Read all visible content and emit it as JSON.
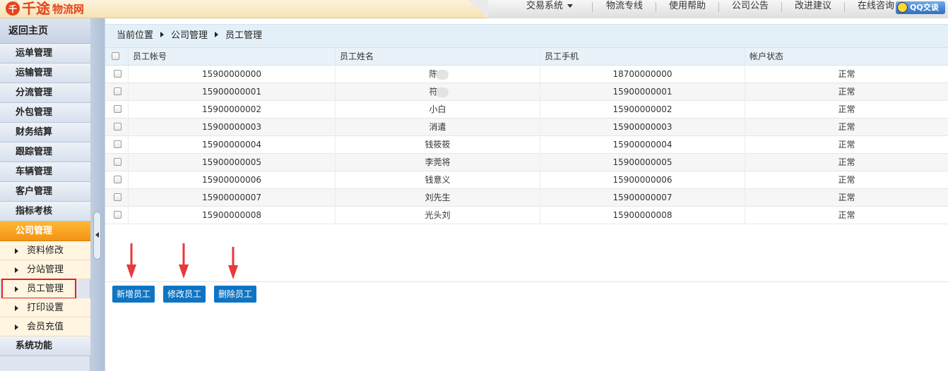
{
  "header": {
    "logo_mark": "千",
    "logo_main": "千途",
    "logo_sub": "物流网",
    "nav": [
      {
        "label": "交易系统"
      },
      {
        "label": "物流专线"
      },
      {
        "label": "使用帮助"
      },
      {
        "label": "公司公告"
      },
      {
        "label": "改进建议"
      },
      {
        "label": "在线咨询"
      }
    ],
    "qq_label": "QQ交谈"
  },
  "sidebar": {
    "home": "返回主页",
    "items": [
      {
        "label": "运单管理"
      },
      {
        "label": "运输管理"
      },
      {
        "label": "分流管理"
      },
      {
        "label": "外包管理"
      },
      {
        "label": "财务结算"
      },
      {
        "label": "跟踪管理"
      },
      {
        "label": "车辆管理"
      },
      {
        "label": "客户管理"
      },
      {
        "label": "指标考核"
      },
      {
        "label": "公司管理"
      }
    ],
    "sub_items": [
      {
        "label": "资料修改"
      },
      {
        "label": "分站管理"
      },
      {
        "label": "员工管理"
      },
      {
        "label": "打印设置"
      },
      {
        "label": "会员充值"
      }
    ],
    "last_item": "系统功能"
  },
  "breadcrumb": {
    "root": "当前位置",
    "level1": "公司管理",
    "level2": "员工管理"
  },
  "table": {
    "columns": [
      "员工帐号",
      "员工姓名",
      "员工手机",
      "帐户状态"
    ],
    "rows": [
      {
        "account": "15900000000",
        "name_a": "陈",
        "name_b": "",
        "phone": "18700000000",
        "status": "正常",
        "blurred": true
      },
      {
        "account": "15900000001",
        "name_a": "符",
        "name_b": "",
        "phone": "15900000001",
        "status": "正常",
        "blurred": true
      },
      {
        "account": "15900000002",
        "name_a": "小白",
        "name_b": "",
        "phone": "15900000002",
        "status": "正常",
        "blurred": false
      },
      {
        "account": "15900000003",
        "name_a": "消遣",
        "name_b": "",
        "phone": "15900000003",
        "status": "正常",
        "blurred": false
      },
      {
        "account": "15900000004",
        "name_a": "钱筱筱",
        "name_b": "",
        "phone": "15900000004",
        "status": "正常",
        "blurred": false
      },
      {
        "account": "15900000005",
        "name_a": "李莞将",
        "name_b": "",
        "phone": "15900000005",
        "status": "正常",
        "blurred": false
      },
      {
        "account": "15900000006",
        "name_a": "钱意义",
        "name_b": "",
        "phone": "15900000006",
        "status": "正常",
        "blurred": false
      },
      {
        "account": "15900000007",
        "name_a": "刘先生",
        "name_b": "",
        "phone": "15900000007",
        "status": "正常",
        "blurred": false
      },
      {
        "account": "15900000008",
        "name_a": "光头刘",
        "name_b": "",
        "phone": "15900000008",
        "status": "正常",
        "blurred": false
      }
    ]
  },
  "actions": {
    "add": "新增员工",
    "edit": "修改员工",
    "delete": "删除员工"
  },
  "colors": {
    "accent": "#0f75c3",
    "active_menu": "#f39414",
    "annotation": "#e83a3a"
  }
}
